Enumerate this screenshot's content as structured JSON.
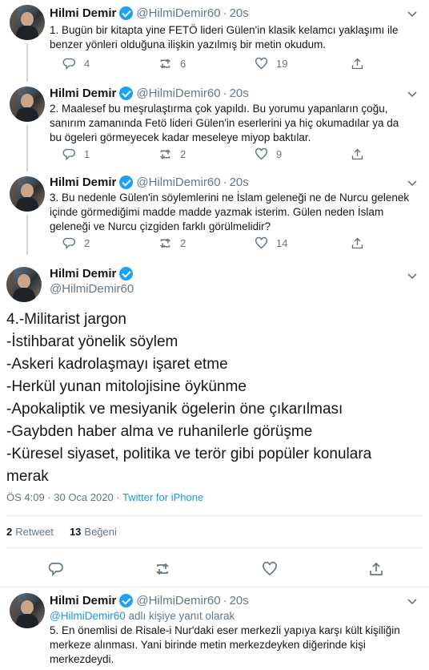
{
  "author": {
    "name": "Hilmi Demir",
    "handle": "@HilmiDemir60"
  },
  "separator": "·",
  "tweets": [
    {
      "time": "20s",
      "text": "1. Bugün bir kitapta yine FETÖ lideri Gülen'in klasik kelamcı yaklaşımı ile benzer yönleri olduğuna ilişkin yazılmış bir metin okudum.",
      "replies": "4",
      "retweets": "6",
      "likes": "19"
    },
    {
      "time": "20s",
      "text": "2. Maalesef bu meşrulaştırma çok yapıldı. Bu yorumu yapanların çoğu, sanırım zamanında Fetö lideri Gülen'in eserlerini ya hiç okumadılar ya da bu ögeleri görmeyecek kadar meseleye miyop baktılar.",
      "replies": "1",
      "retweets": "2",
      "likes": "9"
    },
    {
      "time": "20s",
      "text": "3. Bu nedenle Gülen'in söylemlerini ne İslam geleneği ne de Nurcu gelenek içinde görmediğimi madde madde yazmak isterim. Gülen neden İslam geleneği ve Nurcu çizgiden farklı görülmelidir?",
      "replies": "2",
      "retweets": "2",
      "likes": "14"
    }
  ],
  "main_tweet": {
    "lines": [
      "4.-Militarist jargon",
      "-İstihbarat yönelik söylem",
      "-Askeri kadrolaşmayı işaret etme",
      "-Herkül yunan mitolojisine öykünme",
      "-Apokaliptik ve mesiyanik ögelerin öne çıkarılması",
      "-Gaybden haber alma ve ruhanilerle görüşme",
      "-Küresel siyaset, politika ve terör gibi popüler konulara",
      "merak"
    ],
    "timestamp": "ÖS 4:09 · 30 Oca 2020 · ",
    "source": "Twitter for iPhone",
    "retweet_count": "2",
    "retweet_label": "Retweet",
    "like_count": "13",
    "like_label": "Beğeni"
  },
  "reply_tweet": {
    "time": "20s",
    "reply_to_mention": "@HilmiDemir60",
    "reply_to_suffix": " adlı kişiye yanıt olarak",
    "text": "5. En önemlisi de Risale-i Nur'daki eser merkezli yapıya karşı kült kişiliğin merkeze alınması. Yani birinde metin merkezdeyken diğerinde kişi merkezdeydi."
  },
  "colors": {
    "accent": "#1da1f2",
    "link": "#1b95e0",
    "muted": "#657786",
    "text": "#14171a"
  },
  "icons": [
    "chevron-down-icon",
    "verified-badge-icon",
    "reply-icon",
    "retweet-icon",
    "like-icon",
    "share-icon"
  ]
}
